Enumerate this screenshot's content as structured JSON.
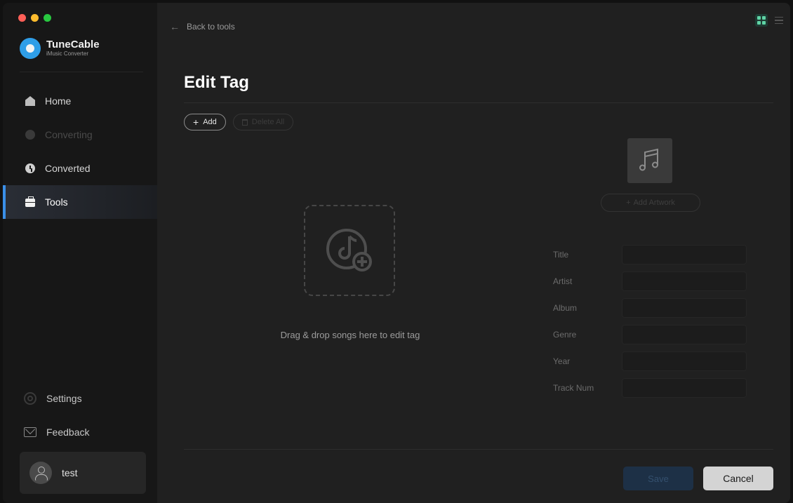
{
  "app": {
    "name": "TuneCable",
    "subtitle": "iMusic Converter"
  },
  "sidebar": {
    "items": [
      {
        "label": "Home",
        "icon": "home-icon",
        "state": "normal"
      },
      {
        "label": "Converting",
        "icon": "converting-icon",
        "state": "disabled"
      },
      {
        "label": "Converted",
        "icon": "clock-icon",
        "state": "normal"
      },
      {
        "label": "Tools",
        "icon": "toolbox-icon",
        "state": "active"
      }
    ],
    "bottom_items": [
      {
        "label": "Settings",
        "icon": "gear-icon"
      },
      {
        "label": "Feedback",
        "icon": "mail-icon"
      }
    ],
    "user": {
      "name": "test"
    }
  },
  "header": {
    "back_label": "Back to tools"
  },
  "page": {
    "title": "Edit Tag",
    "add_label": "Add",
    "delete_all_label": "Delete All",
    "drop_text": "Drag & drop songs here to edit tag",
    "add_artwork_label": "Add Artwork"
  },
  "tag_fields": [
    {
      "label": "Title",
      "value": ""
    },
    {
      "label": "Artist",
      "value": ""
    },
    {
      "label": "Album",
      "value": ""
    },
    {
      "label": "Genre",
      "value": ""
    },
    {
      "label": "Year",
      "value": ""
    },
    {
      "label": "Track Num",
      "value": ""
    }
  ],
  "footer": {
    "save_label": "Save",
    "cancel_label": "Cancel"
  },
  "colors": {
    "accent": "#3a8fe8",
    "brand": "#2f9ee8",
    "grid_view_active": "#5fd3a5",
    "background": "#202020",
    "sidebar": "#171717"
  }
}
